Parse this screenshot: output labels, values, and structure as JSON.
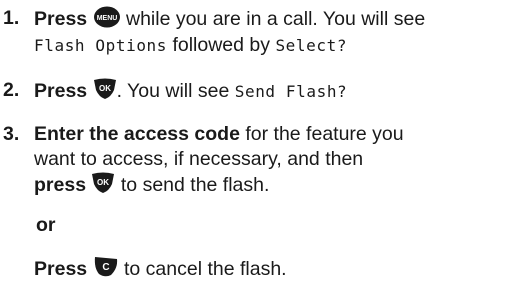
{
  "steps": [
    {
      "number": "1.",
      "line1": {
        "bold": "Press",
        "text_after_icon": "while you are in a call. You will see"
      },
      "line2": {
        "mono1": "Flash Options",
        "mid": "followed by",
        "mono2": "Select?"
      },
      "icon": "menu-key-icon",
      "icon_label": "MENU"
    },
    {
      "number": "2.",
      "line1": {
        "bold": "Press",
        "text_after_icon": ". You will see",
        "mono": "Send Flash?"
      },
      "icon": "ok-key-icon",
      "icon_label": "OK"
    },
    {
      "number": "3.",
      "line1": {
        "bold": "Enter the access code",
        "text": "for the feature you"
      },
      "line2": {
        "text": "want to access, if necessary, and then"
      },
      "line3": {
        "bold": "press",
        "text_after_icon": "to send the flash."
      },
      "icon": "ok-key-icon",
      "icon_label": "OK",
      "or_label": "or",
      "alt": {
        "bold": "Press",
        "text_after_icon": "to cancel the flash."
      },
      "alt_icon": "c-key-icon",
      "alt_icon_label": "C"
    }
  ],
  "colors": {
    "text": "#1a1a1a",
    "key": "#1a1a1a",
    "key_text": "#ffffff"
  }
}
